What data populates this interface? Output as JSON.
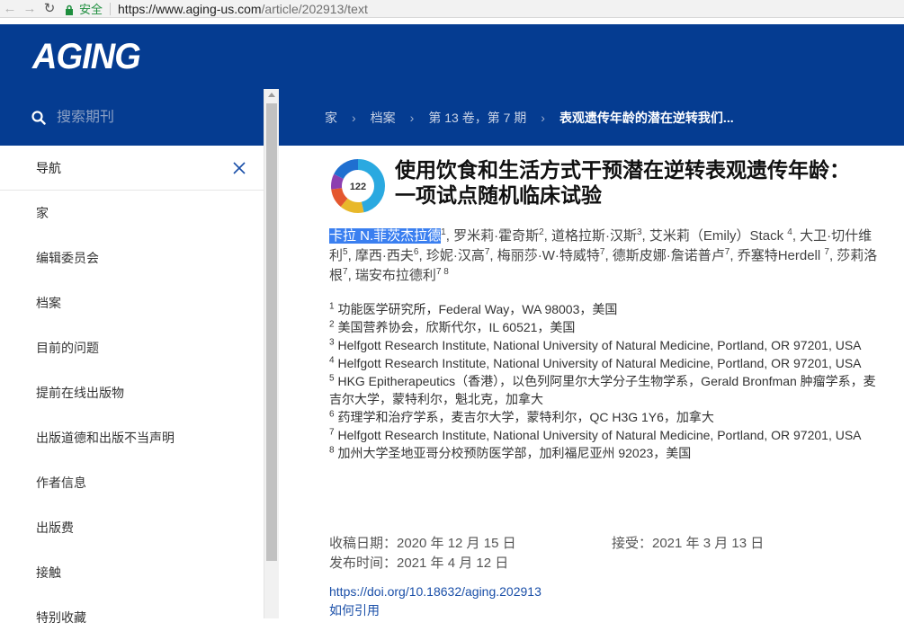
{
  "browser": {
    "secure_label": "安全",
    "url_main": "https://www.aging-us.com",
    "url_path": "/article/202913/text"
  },
  "header": {
    "logo": "AGING"
  },
  "sidebar": {
    "search_placeholder": "搜索期刊",
    "nav_title": "导航",
    "items": [
      "家",
      "编辑委员会",
      "档案",
      "目前的问题",
      "提前在线出版物",
      "出版道德和出版不当声明",
      "作者信息",
      "出版费",
      "接触",
      "特别收藏"
    ]
  },
  "breadcrumb": [
    "家",
    "档案",
    "第 13 卷，第 7 期",
    "表观遗传年龄的潜在逆转我们..."
  ],
  "article": {
    "altmetric_score": "122",
    "title": "使用饮食和生活方式干预潜在逆转表观遗传年龄：一项试点随机临床试验",
    "authors": [
      {
        "name": "卡拉 N.菲茨杰拉德",
        "sup": "1"
      },
      {
        "name": "罗米莉·霍奇斯",
        "sup": "2"
      },
      {
        "name": "道格拉斯·汉斯",
        "sup": "3"
      },
      {
        "name": "艾米莉（Emily）Stack ",
        "sup": "4"
      },
      {
        "name": "大卫·切什维利",
        "sup": "5"
      },
      {
        "name": "摩西·西夫",
        "sup": "6"
      },
      {
        "name": "珍妮·汉高",
        "sup": "7"
      },
      {
        "name": "梅丽莎·W·特威特",
        "sup": "7"
      },
      {
        "name": "德斯皮娜·詹诺普卢",
        "sup": "7"
      },
      {
        "name": "乔塞特Herdell ",
        "sup": "7"
      },
      {
        "name": " 莎莉洛根",
        "sup": "7"
      },
      {
        "name": "瑞安布拉德利",
        "sup": "7 8"
      }
    ],
    "affiliations": [
      {
        "num": "1",
        "text": "功能医学研究所，Federal Way，WA 98003，美国"
      },
      {
        "num": "2",
        "text": "美国营养协会，欣斯代尔，IL 60521，美国"
      },
      {
        "num": "3",
        "text": "Helfgott Research Institute, National University of Natural Medicine, Portland, OR 97201, USA"
      },
      {
        "num": "4",
        "text": "Helfgott Research Institute, National University of Natural Medicine, Portland, OR 97201, USA"
      },
      {
        "num": "5",
        "text": "HKG Epitherapeutics（香港），以色列阿里尔大学分子生物学系，Gerald Bronfman 肿瘤学系，麦吉尔大学，蒙特利尔，魁北克，加拿大"
      },
      {
        "num": "6",
        "text": "药理学和治疗学系，麦吉尔大学，蒙特利尔，QC H3G 1Y6，加拿大"
      },
      {
        "num": "7",
        "text": "Helfgott Research Institute, National University of Natural Medicine, Portland, OR 97201, USA"
      },
      {
        "num": "8",
        "text": "加州大学圣地亚哥分校预防医学部，加利福尼亚州 92023，美国"
      }
    ],
    "received": "收稿日期：2020 年 12 月 15 日",
    "accepted": "接受：2021 年 3 月 13 日",
    "published": "发布时间：2021 年 4 月 12 日",
    "doi": "https://doi.org/10.18632/aging.202913",
    "cite": "如何引用"
  },
  "colors": {
    "brand_blue": "#053c91",
    "link": "#1a4fa8",
    "selection": "#3a7ff0"
  }
}
